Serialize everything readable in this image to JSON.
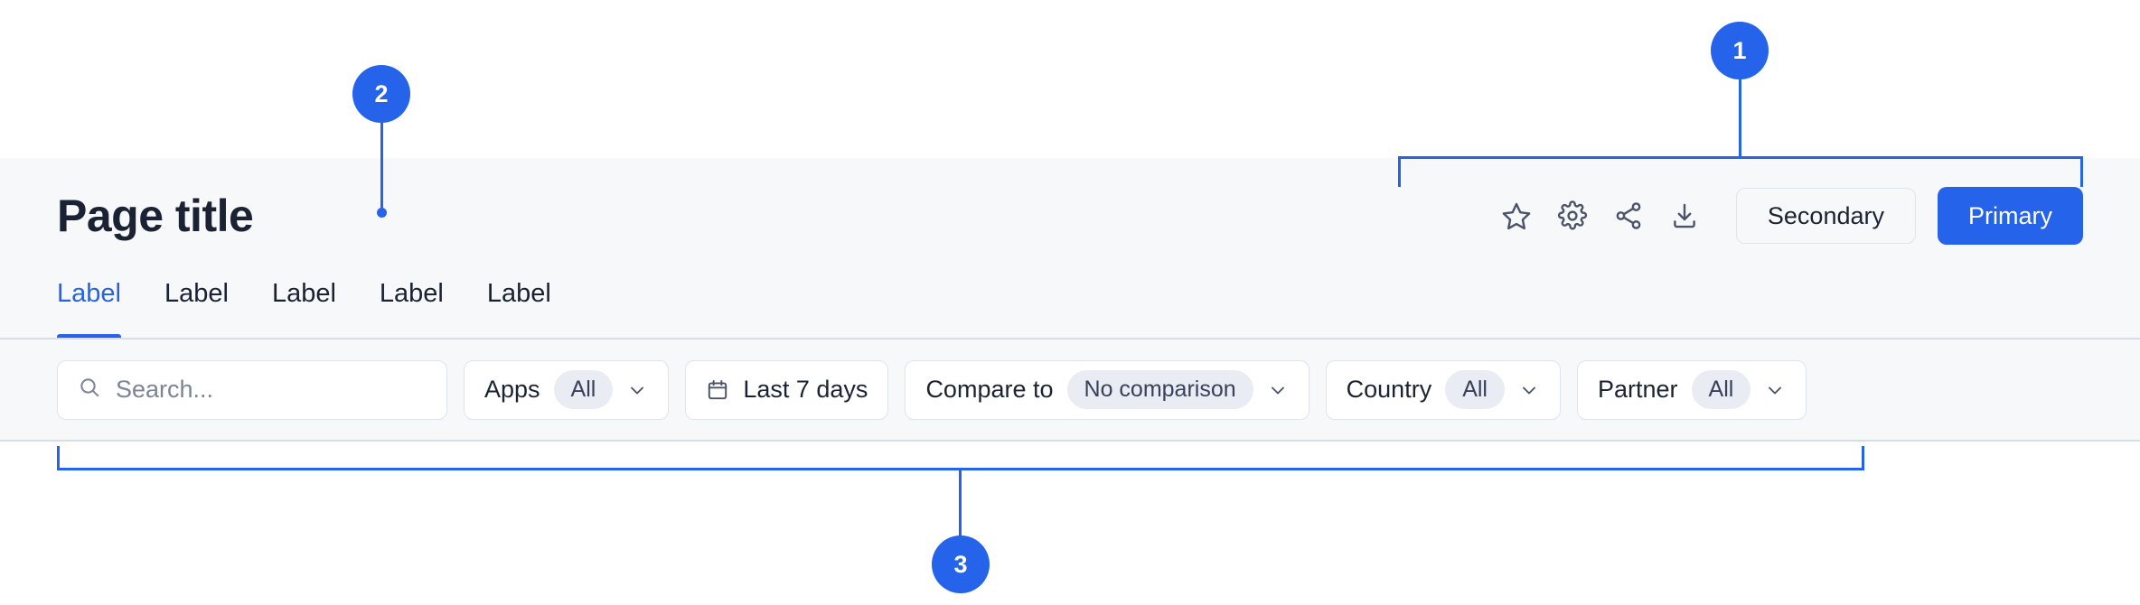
{
  "header": {
    "title": "Page title",
    "actions": {
      "icons": [
        {
          "name": "star-icon",
          "label": "Favorite"
        },
        {
          "name": "gear-icon",
          "label": "Settings"
        },
        {
          "name": "share-icon",
          "label": "Share"
        },
        {
          "name": "download-icon",
          "label": "Download"
        }
      ],
      "secondary_label": "Secondary",
      "primary_label": "Primary"
    }
  },
  "tabs": [
    {
      "label": "Label",
      "active": true
    },
    {
      "label": "Label",
      "active": false
    },
    {
      "label": "Label",
      "active": false
    },
    {
      "label": "Label",
      "active": false
    },
    {
      "label": "Label",
      "active": false
    }
  ],
  "filters": {
    "search": {
      "placeholder": "Search...",
      "value": ""
    },
    "apps": {
      "label": "Apps",
      "value": "All"
    },
    "date": {
      "label": "Last 7 days"
    },
    "compare": {
      "label": "Compare to",
      "value": "No comparison"
    },
    "country": {
      "label": "Country",
      "value": "All"
    },
    "partner": {
      "label": "Partner",
      "value": "All"
    }
  },
  "annotations": [
    {
      "number": "1",
      "target": "header-actions"
    },
    {
      "number": "2",
      "target": "page-title"
    },
    {
      "number": "3",
      "target": "filter-bar"
    }
  ],
  "colors": {
    "accent": "#2563EB",
    "band_bg": "#F7F8FA",
    "page_bg": "#FFFFFF",
    "divider": "#D8DCE8",
    "text": "#1A2233",
    "muted_text": "#7B8499",
    "chip_value_bg": "#E9ECF3",
    "border": "#DFE3EC"
  }
}
